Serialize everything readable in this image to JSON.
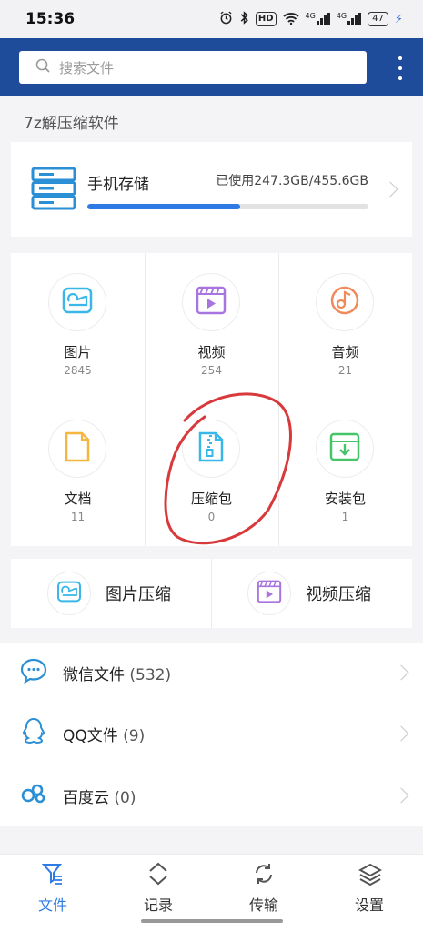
{
  "status_bar": {
    "time": "15:36",
    "hd_label": "HD",
    "network_label": "4G",
    "battery": "47"
  },
  "search": {
    "placeholder": "搜索文件"
  },
  "section_title": "7z解压缩软件",
  "storage": {
    "name": "手机存储",
    "used_text": "已使用247.3GB/455.6GB",
    "used_fraction": 0.543
  },
  "categories": [
    {
      "label": "图片",
      "count": "2845",
      "icon": "image-icon",
      "color": "#38b7e8"
    },
    {
      "label": "视频",
      "count": "254",
      "icon": "video-icon",
      "color": "#a874e0"
    },
    {
      "label": "音频",
      "count": "21",
      "icon": "music-icon",
      "color": "#f08a5a"
    },
    {
      "label": "文档",
      "count": "11",
      "icon": "document-icon",
      "color": "#f4b63c"
    },
    {
      "label": "压缩包",
      "count": "0",
      "icon": "zip-icon",
      "color": "#38b7e8"
    },
    {
      "label": "安装包",
      "count": "1",
      "icon": "install-icon",
      "color": "#46c46a"
    }
  ],
  "compress": [
    {
      "label": "图片压缩",
      "icon": "image-compress-icon"
    },
    {
      "label": "视频压缩",
      "icon": "video-compress-icon"
    }
  ],
  "list": [
    {
      "label": "微信文件",
      "count": "(532)",
      "icon": "wechat-icon"
    },
    {
      "label": "QQ文件",
      "count": "(9)",
      "icon": "qq-icon"
    },
    {
      "label": "百度云",
      "count": "(0)",
      "icon": "baidu-cloud-icon"
    }
  ],
  "tabs": [
    {
      "label": "文件",
      "icon": "file-filter-icon",
      "active": true
    },
    {
      "label": "记录",
      "icon": "record-icon",
      "active": false
    },
    {
      "label": "传输",
      "icon": "transfer-icon",
      "active": false
    },
    {
      "label": "设置",
      "icon": "layers-icon",
      "active": false
    }
  ],
  "colors": {
    "header": "#1e4c9a",
    "accent": "#2f7be6",
    "annotation": "#d8393b"
  }
}
